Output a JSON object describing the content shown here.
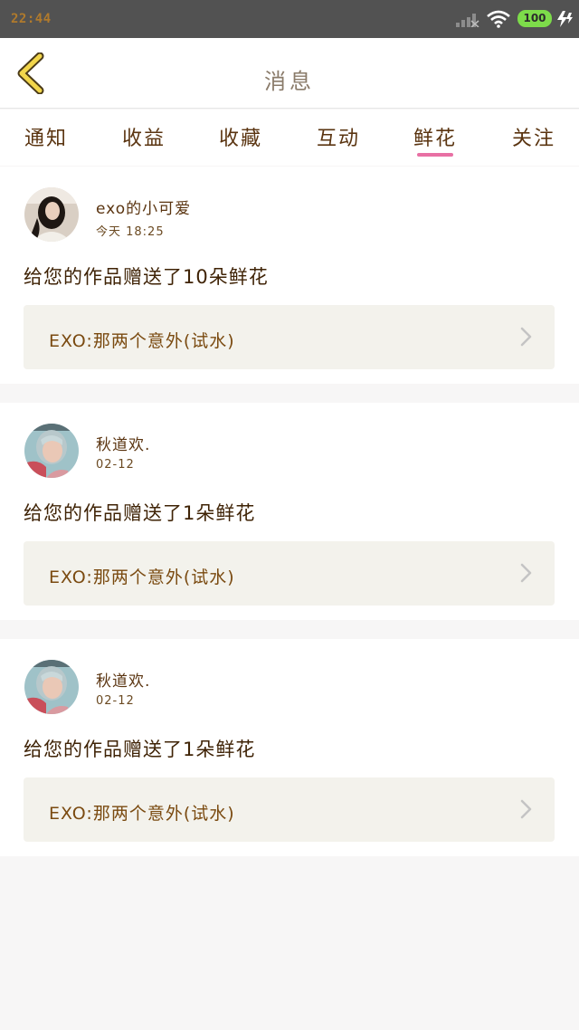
{
  "status_bar": {
    "time": "22:44",
    "battery": "100",
    "icons": [
      "signal-icon",
      "wifi-icon",
      "battery-icon",
      "charging-icon"
    ]
  },
  "header": {
    "back_icon": "back-chevron-icon",
    "title": "消息"
  },
  "tabs": [
    {
      "label": "通知",
      "active": false
    },
    {
      "label": "收益",
      "active": false
    },
    {
      "label": "收藏",
      "active": false
    },
    {
      "label": "互动",
      "active": false
    },
    {
      "label": "鲜花",
      "active": true
    },
    {
      "label": "关注",
      "active": false
    }
  ],
  "messages": [
    {
      "user": "exo的小可爱",
      "date": "今天 18:25",
      "text": "给您的作品赠送了10朵鲜花",
      "work_title": "EXO:那两个意外(试水)"
    },
    {
      "user": "秋道欢.",
      "date": "02-12",
      "text": "给您的作品赠送了1朵鲜花",
      "work_title": "EXO:那两个意外(试水)"
    },
    {
      "user": "秋道欢.",
      "date": "02-12",
      "text": "给您的作品赠送了1朵鲜花",
      "work_title": "EXO:那两个意外(试水)"
    }
  ],
  "colors": {
    "accent_underline": "#e870a4",
    "text_brown": "#5a3410",
    "back_icon_yellow": "#f2d64b",
    "link_bg": "#f3f2ec",
    "page_bg": "#f7f6f6"
  }
}
